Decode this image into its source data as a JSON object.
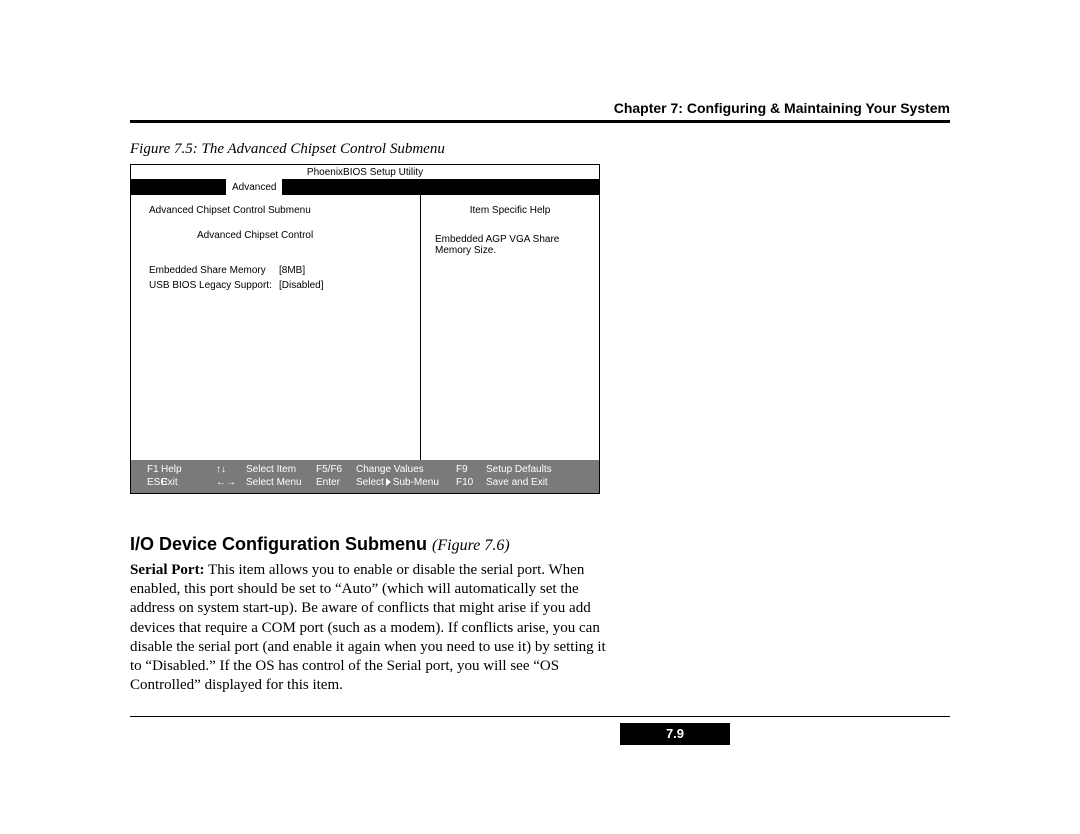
{
  "header": {
    "chapter_title": "Chapter 7: Configuring & Maintaining Your System"
  },
  "figure": {
    "caption": "Figure 7.5: The Advanced Chipset Control Submenu"
  },
  "bios": {
    "title": "PhoenixBIOS Setup Utility",
    "tab": "Advanced",
    "left": {
      "title": "Advanced Chipset Control Submenu",
      "subtitle": "Advanced Chipset Control",
      "rows": [
        {
          "label": "Embedded Share Memory",
          "value": "[8MB]"
        },
        {
          "label": "USB BIOS Legacy Support:",
          "value": "[Disabled]"
        }
      ]
    },
    "right": {
      "title": "Item Specific Help",
      "help": "Embedded AGP VGA Share Memory Size."
    },
    "footer": {
      "f1_key": "F1",
      "f1_label": "Help",
      "updown_key": "↑↓",
      "updown_label": "Select Item",
      "f5f6_key": "F5/F6",
      "f5f6_label": "Change Values",
      "f9_key": "F9",
      "f9_label": "Setup Defaults",
      "esc_key": "ESC",
      "esc_label": "Exit",
      "lr_key": "←→",
      "lr_label": "Select Menu",
      "enter_key": "Enter",
      "enter_label_pre": "Select",
      "enter_label_post": "Sub-Menu",
      "f10_key": "F10",
      "f10_label": "Save and Exit"
    }
  },
  "section": {
    "heading": "I/O Device Configuration Submenu",
    "figref": "(Figure 7.6)",
    "lead": "Serial Port:",
    "body": " This item allows you to enable or disable the serial port. When enabled, this port should be set to “Auto” (which will automatically set the address on system start-up). Be aware of conflicts that might arise if you add devices that require a COM port (such as a modem). If conflicts arise, you can disable the serial port (and enable it again when you need to use it) by setting it to “Disabled.” If the OS has control of the Serial port, you will see “OS Controlled” displayed for this item."
  },
  "page_number": "7.9"
}
